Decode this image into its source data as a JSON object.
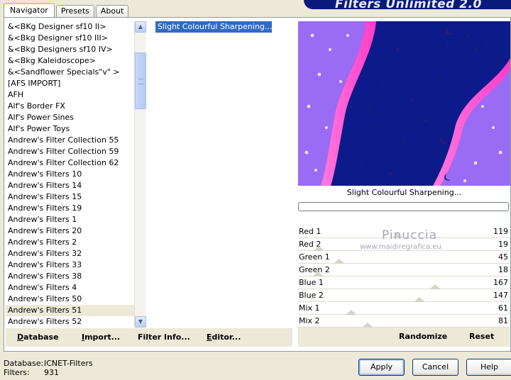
{
  "tabs": [
    "Navigator",
    "Presets",
    "About"
  ],
  "app_title": "Filters Unlimited 2.0",
  "filter_list": {
    "items": [
      "&<BKg Designer sf10 II>",
      "&<Bkg Designer sf10 III>",
      "&<Bkg Designers sf10 IV>",
      "&<Bkg Kaleidoscope>",
      "&<Sandflower Specials\"v\" >",
      "[AFS IMPORT]",
      "AFH",
      "Alf's Border FX",
      "Alf's Power Sines",
      "Alf's Power Toys",
      "Andrew's Filter Collection 55",
      "Andrew's Filter Collection 59",
      "Andrew's Filter Collection 62",
      "Andrew's Filters 10",
      "Andrew's Filters 14",
      "Andrew's Filters 15",
      "Andrew's Filters 19",
      "Andrew's Filters 1",
      "Andrew's Filters 20",
      "Andrew's Filters 2",
      "Andrew's Filters 32",
      "Andrew's Filters 33",
      "Andrew's Filters 38",
      "Andrew's Filters 4",
      "Andrew's Filters 50",
      "Andrew's Filters 51",
      "Andrew's Filters 52"
    ],
    "selected_index": 25
  },
  "effects_list": {
    "items": [
      "Slight Colourful Sharpening..."
    ]
  },
  "preview": {
    "name": "Slight Colourful Sharpening...",
    "progress": 0
  },
  "sliders": [
    {
      "label": "Red 1",
      "value": 119,
      "max": 255
    },
    {
      "label": "Red 2",
      "value": 19,
      "max": 255
    },
    {
      "label": "Green 1",
      "value": 45,
      "max": 255
    },
    {
      "label": "Green 2",
      "value": 18,
      "max": 255
    },
    {
      "label": "Blue 1",
      "value": 167,
      "max": 255
    },
    {
      "label": "Blue 2",
      "value": 147,
      "max": 255
    },
    {
      "label": "Mix 1",
      "value": 61,
      "max": 255
    },
    {
      "label": "Mix 2",
      "value": 81,
      "max": 255
    }
  ],
  "watermark": {
    "name": "Pinuccia",
    "url": "www.maidiregrafica.eu"
  },
  "left_buttons": [
    {
      "first": "D",
      "rest": "atabase"
    },
    {
      "first": "I",
      "rest": "mport..."
    },
    {
      "first": "",
      "rest": "Filter Info..."
    },
    {
      "first": "E",
      "rest": "ditor..."
    }
  ],
  "right_buttons": {
    "randomize": "Randomize",
    "reset": "Reset"
  },
  "status": {
    "database_label": "Database:",
    "database_value": "ICNET-Filters",
    "filters_label": "Filters:",
    "filters_value": "931"
  },
  "dialog_buttons": {
    "apply": "Apply",
    "cancel": "Cancel",
    "help": "Help"
  },
  "colors": {
    "selection": "#316ac5",
    "preview_bg": "#0d1a8a",
    "preview_pink": "#ff5ad2",
    "preview_violet": "#8a5cf0"
  }
}
